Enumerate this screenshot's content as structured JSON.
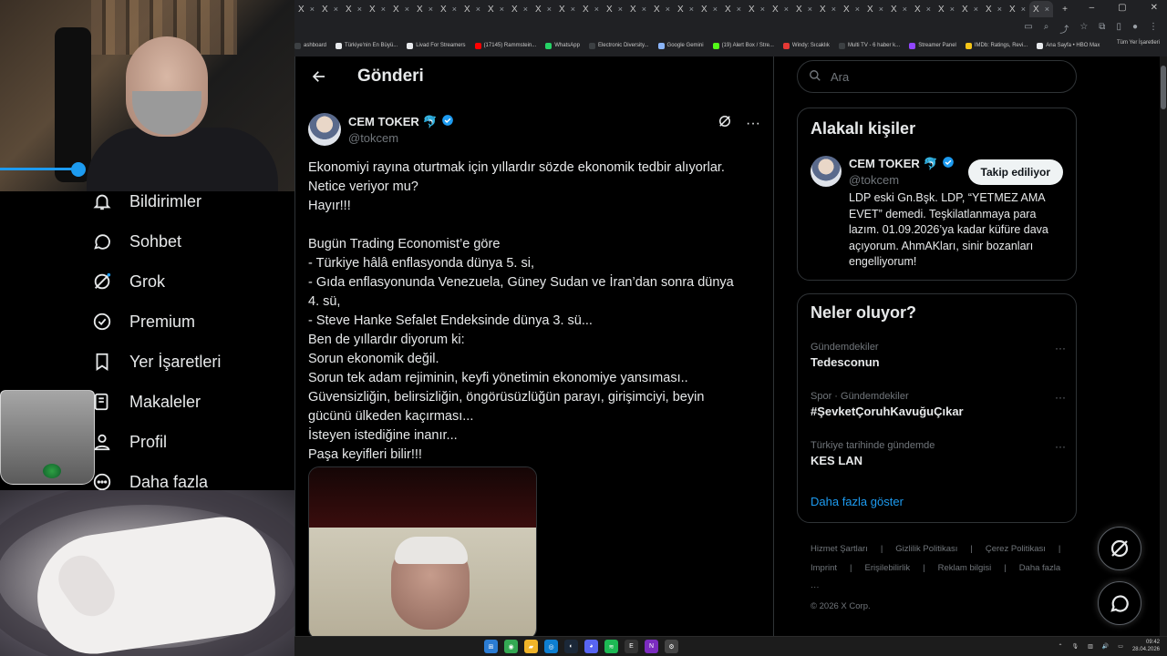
{
  "browser": {
    "tab_labels": [
      "X",
      "X",
      "X",
      "X",
      "X",
      "X",
      "X",
      "X",
      "X",
      "X",
      "X",
      "X",
      "X",
      "X",
      "X",
      "X",
      "X",
      "X",
      "X",
      "X",
      "X",
      "X",
      "X",
      "X",
      "X",
      "X",
      "X",
      "X",
      "X",
      "X",
      "X",
      "X"
    ],
    "bookmarks": [
      {
        "label": "ashboard",
        "color": "#3c4043"
      },
      {
        "label": "Türkiye'nin En Büyü...",
        "color": "#e8eaed"
      },
      {
        "label": "Livad For Streamers",
        "color": "#e8eaed"
      },
      {
        "label": "(17145) Rammstein...",
        "color": "#ff0000"
      },
      {
        "label": "WhatsApp",
        "color": "#25d366"
      },
      {
        "label": "Electronic Diversity...",
        "color": "#3c4043"
      },
      {
        "label": "Google Gemini",
        "color": "#8ab4f8"
      },
      {
        "label": "(19) Alert Box / Stre...",
        "color": "#53fc18"
      },
      {
        "label": "Windy: Sıcaklık",
        "color": "#e53935"
      },
      {
        "label": "Multi TV - 6 haber k...",
        "color": "#3c4043"
      },
      {
        "label": "Streamer Panel",
        "color": "#9146ff"
      },
      {
        "label": "IMDb: Ratings, Revi...",
        "color": "#f5c518"
      },
      {
        "label": "Ana Sayfa • HBO Max",
        "color": "#e8eaed"
      }
    ],
    "all_bookmarks": "Tüm Yer İşaretleri"
  },
  "sidebar": {
    "items": [
      {
        "label": "Bildirimler",
        "icon": "bell-icon"
      },
      {
        "label": "Sohbet",
        "icon": "chat-icon"
      },
      {
        "label": "Grok",
        "icon": "grok-icon"
      },
      {
        "label": "Premium",
        "icon": "verified-icon"
      },
      {
        "label": "Yer İşaretleri",
        "icon": "bookmark-icon"
      },
      {
        "label": "Makaleler",
        "icon": "article-icon"
      },
      {
        "label": "Profil",
        "icon": "profile-icon"
      },
      {
        "label": "Daha fazla",
        "icon": "more-icon"
      }
    ]
  },
  "post": {
    "header_title": "Gönderi",
    "author_name": "CEM TOKER",
    "author_emoji": "🐬",
    "author_handle": "@tokcem",
    "lines": [
      "Ekonomiyi rayına oturtmak için yıllardır sözde ekonomik tedbir alıyorlar.",
      "Netice veriyor mu?",
      "Hayır!!!",
      "",
      "Bugün Trading Economist’e göre",
      "- Türkiye hâlâ enflasyonda dünya 5. si,",
      "- Gıda enflasyonunda Venezuela, Güney Sudan ve İran’dan sonra dünya",
      "4. sü,",
      "- Steve Hanke Sefalet Endeksinde dünya 3. sü...",
      "Ben de yıllardır diyorum ki:",
      "Sorun ekonomik değil.",
      "Sorun tek adam rejiminin, keyfi yönetimin ekonomiye yansıması..",
      "Güvensizliğin, belirsizliğin, öngörüsüzlüğün parayı, girişimciyi, beyin",
      "gücünü ülkeden kaçırması...",
      "İsteyen istediğine inanır...",
      "Paşa keyifleri bilir!!!"
    ]
  },
  "right": {
    "search_placeholder": "Ara",
    "related_title": "Alakalı kişiler",
    "related_name": "CEM TOKER",
    "related_emoji": "🐬",
    "related_handle": "@tokcem",
    "follow_label": "Takip ediliyor",
    "bio": "LDP eski Gn.Bşk. LDP, “YETMEZ AMA EVET” demedi. Teşkilatlanmaya para lazım. 01.09.2026’ya kadar küfüre dava açıyorum. AhmAKları, sinir bozanları engelliyorum!",
    "trends_title": "Neler oluyor?",
    "trends": [
      {
        "context": "Gündemdekiler",
        "topic": "Tedesconun"
      },
      {
        "context": "Spor · Gündemdekiler",
        "topic": "#ŞevketÇoruhKavuğuÇıkar"
      },
      {
        "context": "Türkiye tarihinde gündemde",
        "topic": "KES LAN"
      }
    ],
    "show_more": "Daha fazla göster",
    "footer_links": [
      "Hizmet Şartları",
      "|",
      "Gizlilik Politikası",
      "|",
      "Çerez Politikası",
      "|"
    ],
    "footer_links2": [
      "Imprint",
      "|",
      "Erişilebilirlik",
      "|",
      "Reklam bilgisi",
      "|",
      "Daha fazla ···"
    ],
    "copyright": "© 2026 X Corp."
  },
  "taskbar": {
    "time": "09:42",
    "date": "28.04.2026"
  },
  "colors": {
    "accent": "#1d9bf0",
    "background": "#000000",
    "border": "#2f3336",
    "muted": "#71767b"
  }
}
